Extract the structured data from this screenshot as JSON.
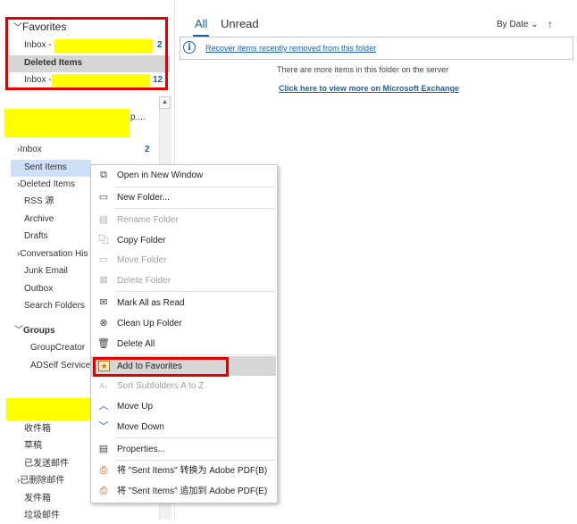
{
  "favorites": {
    "header": "Favorites",
    "items": [
      {
        "label": "Inbox - ?",
        "count": "2"
      },
      {
        "label": "Deleted Items",
        "count": ""
      },
      {
        "label": "Inbox - ",
        "count": "12"
      }
    ]
  },
  "mailbox": {
    "name_suffix": "p....",
    "folders": [
      {
        "label": "Inbox",
        "count": "2",
        "expand": "›"
      },
      {
        "label": "Sent Items",
        "count": ""
      },
      {
        "label": "Deleted Items",
        "count": "",
        "expand": "›"
      },
      {
        "label": "RSS 源",
        "count": ""
      },
      {
        "label": "Archive",
        "count": ""
      },
      {
        "label": "Drafts",
        "count": ""
      },
      {
        "label": "Conversation His",
        "count": "",
        "expand": "›"
      },
      {
        "label": "Junk Email",
        "count": ""
      },
      {
        "label": "Outbox",
        "count": ""
      },
      {
        "label": "Search Folders",
        "count": ""
      }
    ]
  },
  "groups": {
    "header": "Groups",
    "items": [
      "GroupCreator",
      "ADSelf Service P"
    ]
  },
  "second_mailbox": {
    "folders": [
      "收件箱",
      "草稿",
      "已发送邮件",
      "已删除邮件",
      "发件箱",
      "垃圾邮件"
    ]
  },
  "message_list": {
    "tabs": {
      "all": "All",
      "unread": "Unread"
    },
    "sort_label": "By Date",
    "sort_chevron": "⌄",
    "sort_arrow": "↑",
    "banner_text": "Recover items recently removed from this folder",
    "server_note": "There are more items in this folder on the server",
    "exchange_link": "Click here to view more on Microsoft Exchange"
  },
  "context_menu": {
    "open_new_window": "Open in New Window",
    "new_folder": "New Folder...",
    "rename_folder": "Rename Folder",
    "copy_folder": "Copy Folder",
    "move_folder": "Move Folder",
    "delete_folder": "Delete Folder",
    "mark_all_read": "Mark All as Read",
    "clean_up_folder": "Clean Up Folder",
    "delete_all": "Delete All",
    "add_to_favorites": "Add to Favorites",
    "sort_subfolders": "Sort Subfolders A to Z",
    "move_up": "Move Up",
    "move_down": "Move Down",
    "properties": "Properties...",
    "convert_pdf": "将 \"Sent Items\" 转换为 Adobe PDF(B)",
    "append_pdf": "将 \"Sent Items\" 追加到 Adobe PDF(E)"
  },
  "colors": {
    "accent": "#1a5fb4",
    "highlight_box": "#e00000",
    "redaction": "#ffff00",
    "selection": "#cde0f7"
  }
}
